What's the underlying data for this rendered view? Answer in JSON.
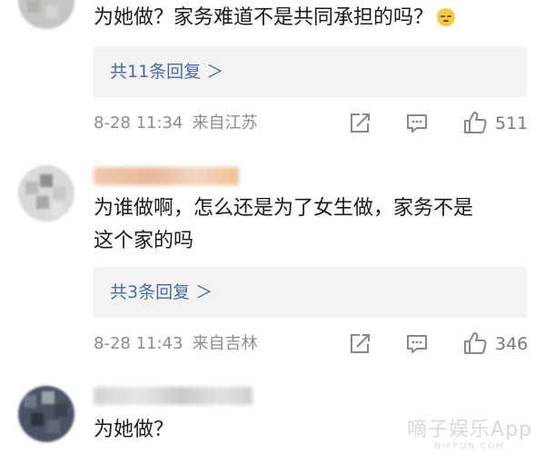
{
  "comments": [
    {
      "text": "为她做？家务难道不是共同承担的吗？",
      "emoji": "face-emoji",
      "replies_label": "共11条回复 ＞",
      "time": "8-28 11:34",
      "location": "来自江苏",
      "likes": "511"
    },
    {
      "text_line1": "为谁做啊，怎么还是为了女生做，家务不是",
      "text_line2": "这个家的吗",
      "replies_label": "共3条回复 ＞",
      "time": "8-28 11:43",
      "location": "来自吉林",
      "likes": "346"
    },
    {
      "text": "为她做？"
    }
  ],
  "icons": {
    "repost": "repost-icon",
    "comment": "comment-icon",
    "like": "thumbs-up-icon"
  },
  "watermark": {
    "main": "嘀子娱乐App",
    "sub": "NIPPON.COM"
  },
  "colors": {
    "link": "#4a6b9c",
    "meta": "#8c8c8c",
    "reply_bg": "#f3f3f3"
  }
}
